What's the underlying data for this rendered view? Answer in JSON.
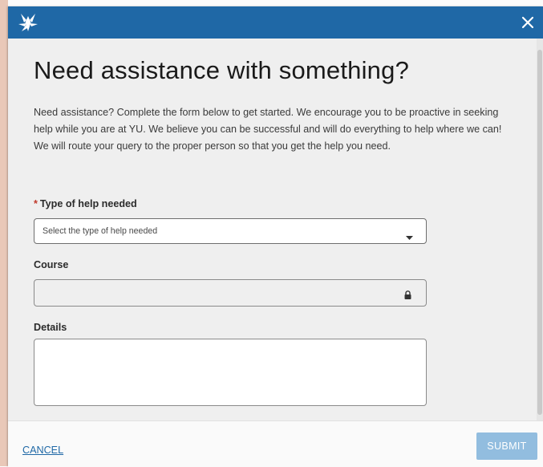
{
  "header": {
    "logo_icon": "star-burst-icon",
    "close_icon": "close-icon",
    "bar_color": "#1f68a6"
  },
  "title": "Need assistance with something?",
  "intro": "Need assistance? Complete the form below to get started. We encourage you to be proactive in seeking help while you are at YU. We believe you can be successful and will do everything to help where we can! We will route your query to the proper person so that you get the help you need.",
  "form": {
    "help_type": {
      "required_marker": "*",
      "label": "Type of help needed",
      "placeholder": "Select the type of help needed",
      "icon": "chevron-down-icon"
    },
    "course": {
      "label": "Course",
      "value": "",
      "icon": "lock-icon"
    },
    "details": {
      "label": "Details",
      "value": ""
    }
  },
  "footer": {
    "cancel_label": "CANCEL",
    "submit_label": "SUBMIT",
    "submit_color": "#92bddf"
  }
}
